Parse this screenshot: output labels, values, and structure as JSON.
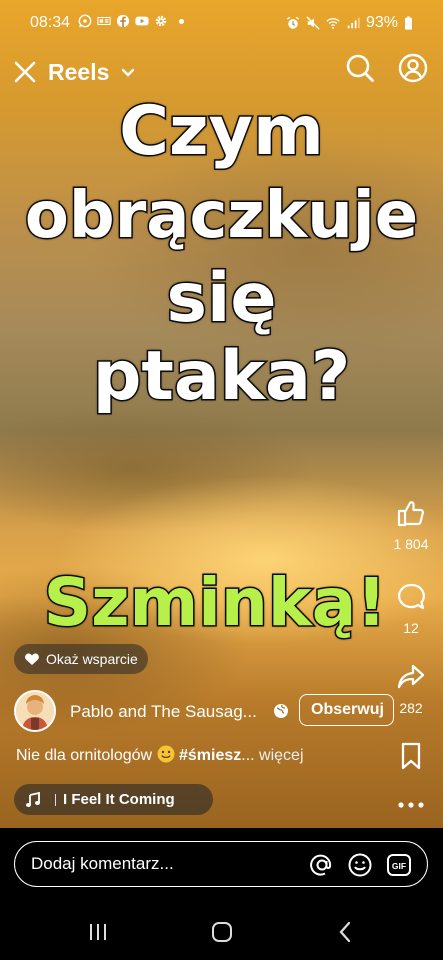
{
  "status_bar": {
    "time": "08:34",
    "battery": "93%",
    "left_icons": [
      "whatsapp-icon",
      "news-icon",
      "facebook-icon",
      "youtube-icon",
      "settings-icon"
    ],
    "right_icons": [
      "alarm-icon",
      "mute-icon",
      "wifi-icon",
      "signal-icon",
      "battery-icon"
    ]
  },
  "header": {
    "title": "Reels"
  },
  "overlay": {
    "question_lines": [
      "Czym",
      "obrączkuje",
      "się",
      "ptaka?"
    ],
    "answer": "Szminką!",
    "answer_color": "#b7f04a"
  },
  "actions": {
    "likes": "1 804",
    "comments": "12",
    "shares": "282"
  },
  "support_chip": {
    "label": "Okaż wsparcie"
  },
  "author": {
    "name": "Pablo and The Sausag...",
    "follow_label": "Obserwuj"
  },
  "description": {
    "text": "Nie dla ornitologów",
    "hashtag": "#śmiesz",
    "ellipsis": "...",
    "more": "więcej"
  },
  "music": {
    "title": "I Feel It Coming"
  },
  "comment": {
    "placeholder": "Dodaj komentarz..."
  },
  "colors": {
    "accent": "#b7f04a",
    "background": "#000000"
  }
}
